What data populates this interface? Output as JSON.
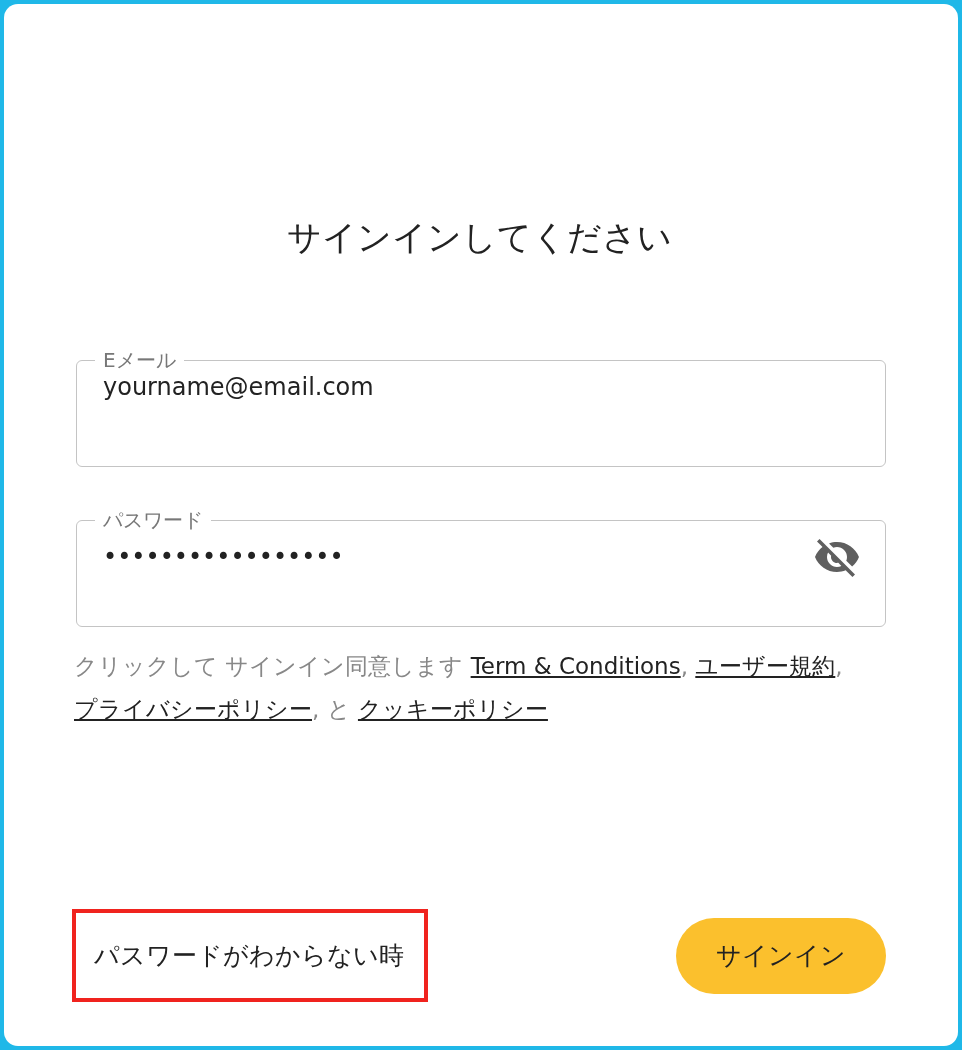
{
  "title": "サインインしてください",
  "fields": [
    {
      "label": "Eメール",
      "value": "yourname@email.com",
      "kind": "text"
    },
    {
      "label": "パスワード",
      "value": "•••••••••••••••••",
      "kind": "password"
    }
  ],
  "consent": [
    {
      "kind": "text",
      "text": "クリックして サインイン同意します "
    },
    {
      "kind": "link",
      "text": "Term & Conditions"
    },
    {
      "kind": "text",
      "text": ", "
    },
    {
      "kind": "link",
      "text": "ユーザー規約"
    },
    {
      "kind": "text",
      "text": ", "
    },
    {
      "kind": "link",
      "text": "プライバシーポリシー"
    },
    {
      "kind": "text",
      "text": ", と "
    },
    {
      "kind": "link",
      "text": "クッキーポリシー"
    }
  ],
  "forgot_link": {
    "text": "パスワードがわからない時",
    "highlighted": true
  },
  "sign_in_button": {
    "label": "サインイン"
  }
}
